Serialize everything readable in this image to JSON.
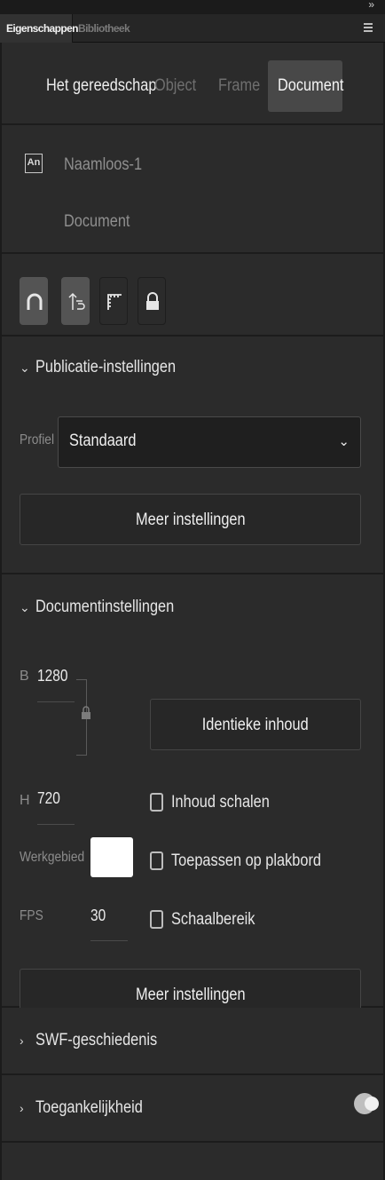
{
  "panel": {
    "collapse_glyph": "»",
    "tabs": [
      "Eigenschappen",
      "Bibliotheek"
    ],
    "menu_icon": "hamburger-menu-icon"
  },
  "mode_tabs": [
    {
      "label": "Het gereedschap"
    },
    {
      "label": "Object"
    },
    {
      "label": "Frame"
    },
    {
      "label": "Document"
    }
  ],
  "file": {
    "logo": "An",
    "name": "Naamloos-1",
    "kind": "Document"
  },
  "tool_icons": [
    "magnet-snap-icon",
    "swap-edit-icon",
    "ruler-icon",
    "lock-icon"
  ],
  "publish": {
    "title": "Publicatie-instellingen",
    "profile_label": "Profiel",
    "profile_value": "Standaard",
    "more_button": "Meer instellingen"
  },
  "document": {
    "title": "Documentinstellingen",
    "width_label": "B",
    "width_value": "1280",
    "height_label": "H",
    "height_value": "720",
    "match_contents_button": "Identieke inhoud",
    "scale_content": "Inhoud schalen",
    "apply_pasteboard": "Toepassen op plakbord",
    "scale_range": "Schaalbereik",
    "stage_label": "Werkgebied",
    "stage_color": "#ffffff",
    "fps_label": "FPS",
    "fps_value": "30",
    "more_button": "Meer instellingen"
  },
  "swf_history": {
    "title": "SWF-geschiedenis"
  },
  "accessibility": {
    "title": "Toegankelijkheid",
    "toggle_on": true
  }
}
